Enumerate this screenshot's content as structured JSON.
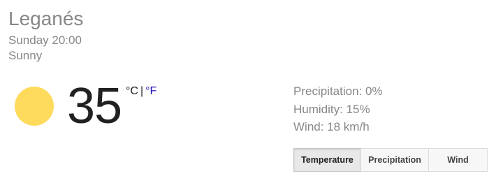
{
  "location": "Leganés",
  "datetime": "Sunday 20:00",
  "condition": "Sunny",
  "condition_icon": "sun-icon",
  "temperature": {
    "value": "35",
    "unit_c": "°C",
    "separator": "|",
    "unit_f": "°F"
  },
  "details": {
    "precipitation": "Precipitation: 0%",
    "humidity": "Humidity: 15%",
    "wind": "Wind: 18 km/h"
  },
  "tabs": [
    {
      "label": "Temperature",
      "active": true
    },
    {
      "label": "Precipitation",
      "active": false
    },
    {
      "label": "Wind",
      "active": false
    }
  ],
  "colors": {
    "sun": "#fedb5c",
    "link": "#1a0dab",
    "muted_text": "#878787"
  }
}
